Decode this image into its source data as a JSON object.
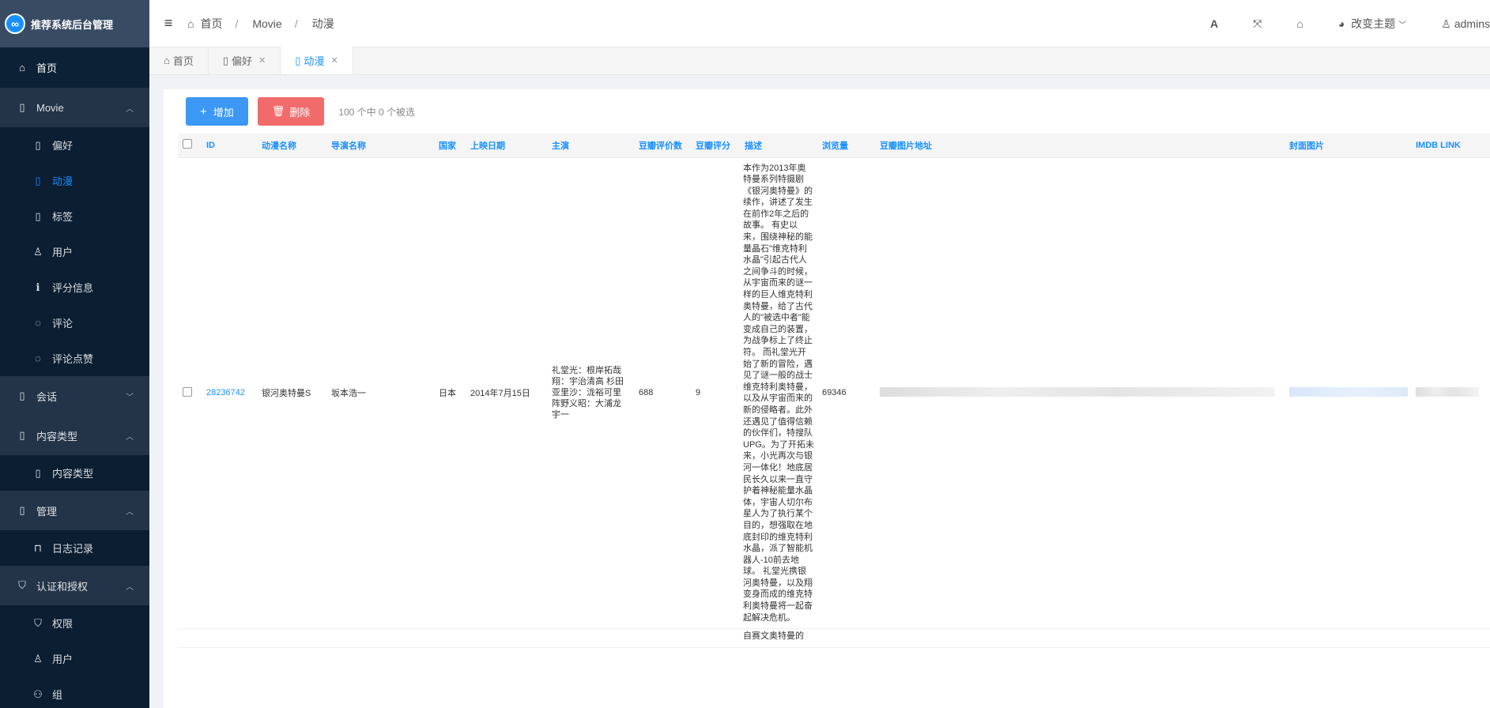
{
  "app": {
    "title": "推荐系统后台管理",
    "logo_icon": "∞"
  },
  "sidebar": {
    "home": "首页",
    "groups": [
      {
        "label": "Movie",
        "items": [
          "偏好",
          "动漫",
          "标签",
          "用户",
          "评分信息",
          "评论",
          "评论点赞"
        ]
      },
      {
        "label": "会话",
        "items": []
      },
      {
        "label": "内容类型",
        "items": [
          "内容类型"
        ]
      },
      {
        "label": "管理",
        "items": [
          "日志记录"
        ]
      },
      {
        "label": "认证和授权",
        "items": [
          "权限",
          "用户",
          "组"
        ]
      }
    ]
  },
  "header": {
    "breadcrumb": [
      "首页",
      "Movie",
      "动漫"
    ],
    "font_btn": "A",
    "theme_label": "改变主题",
    "user_label": "admins"
  },
  "tabs": [
    {
      "label": "首页",
      "closable": false
    },
    {
      "label": "偏好",
      "closable": true
    },
    {
      "label": "动漫",
      "closable": true,
      "active": true
    }
  ],
  "toolbar": {
    "add_label": "增加",
    "delete_label": "删除",
    "selection_text": "100 个中 0 个被选"
  },
  "table": {
    "columns": [
      "ID",
      "动漫名称",
      "导演名称",
      "国家",
      "上映日期",
      "主演",
      "豆瓣评价数",
      "豆瓣评分",
      "描述",
      "浏览量",
      "豆瓣图片地址",
      "封面图片",
      "IMDB LINK"
    ],
    "rows": [
      {
        "id": "28236742",
        "name": "银河奥特曼S",
        "director": "坂本浩一",
        "country": "日本",
        "date": "2014年7月15日",
        "cast": "礼堂光：根岸拓哉 翔：宇治清高 杉田亚里沙：泷裕可里 阵野义昭：大浦龙宇一",
        "rating_count": "688",
        "rating": "9",
        "description": "本作为2013年奥特曼系列特摄剧《银河奥特曼》的续作，讲述了发生在前作2年之后的故事。 有史以来，围绕神秘的能量晶石\"维克特利水晶\"引起古代人之间争斗的时候，从宇宙而来的谜一样的巨人维克特利奥特曼，给了古代人的\"被选中者\"能变成自己的装置，为战争标上了终止符。 而礼堂光开始了新的冒险，遇见了谜一般的战士维克特利奥特曼，以及从宇宙而来的新的侵略者。此外还遇见了值得信赖的伙伴们，特搜队UPG。为了开拓未来，小光再次与银河一体化！地底居民长久以来一直守护着神秘能量水晶体，宇宙人切尔布星人为了执行某个目的，想强取在地底封印的维克特利水晶，派了智能机器人-10前去地球。 礼堂光携银河奥特曼，以及翔变身而成的维克特利奥特曼将一起奋起解决危机。",
        "views": "69346"
      },
      {
        "description": "自赛文奥特曼的"
      }
    ]
  }
}
